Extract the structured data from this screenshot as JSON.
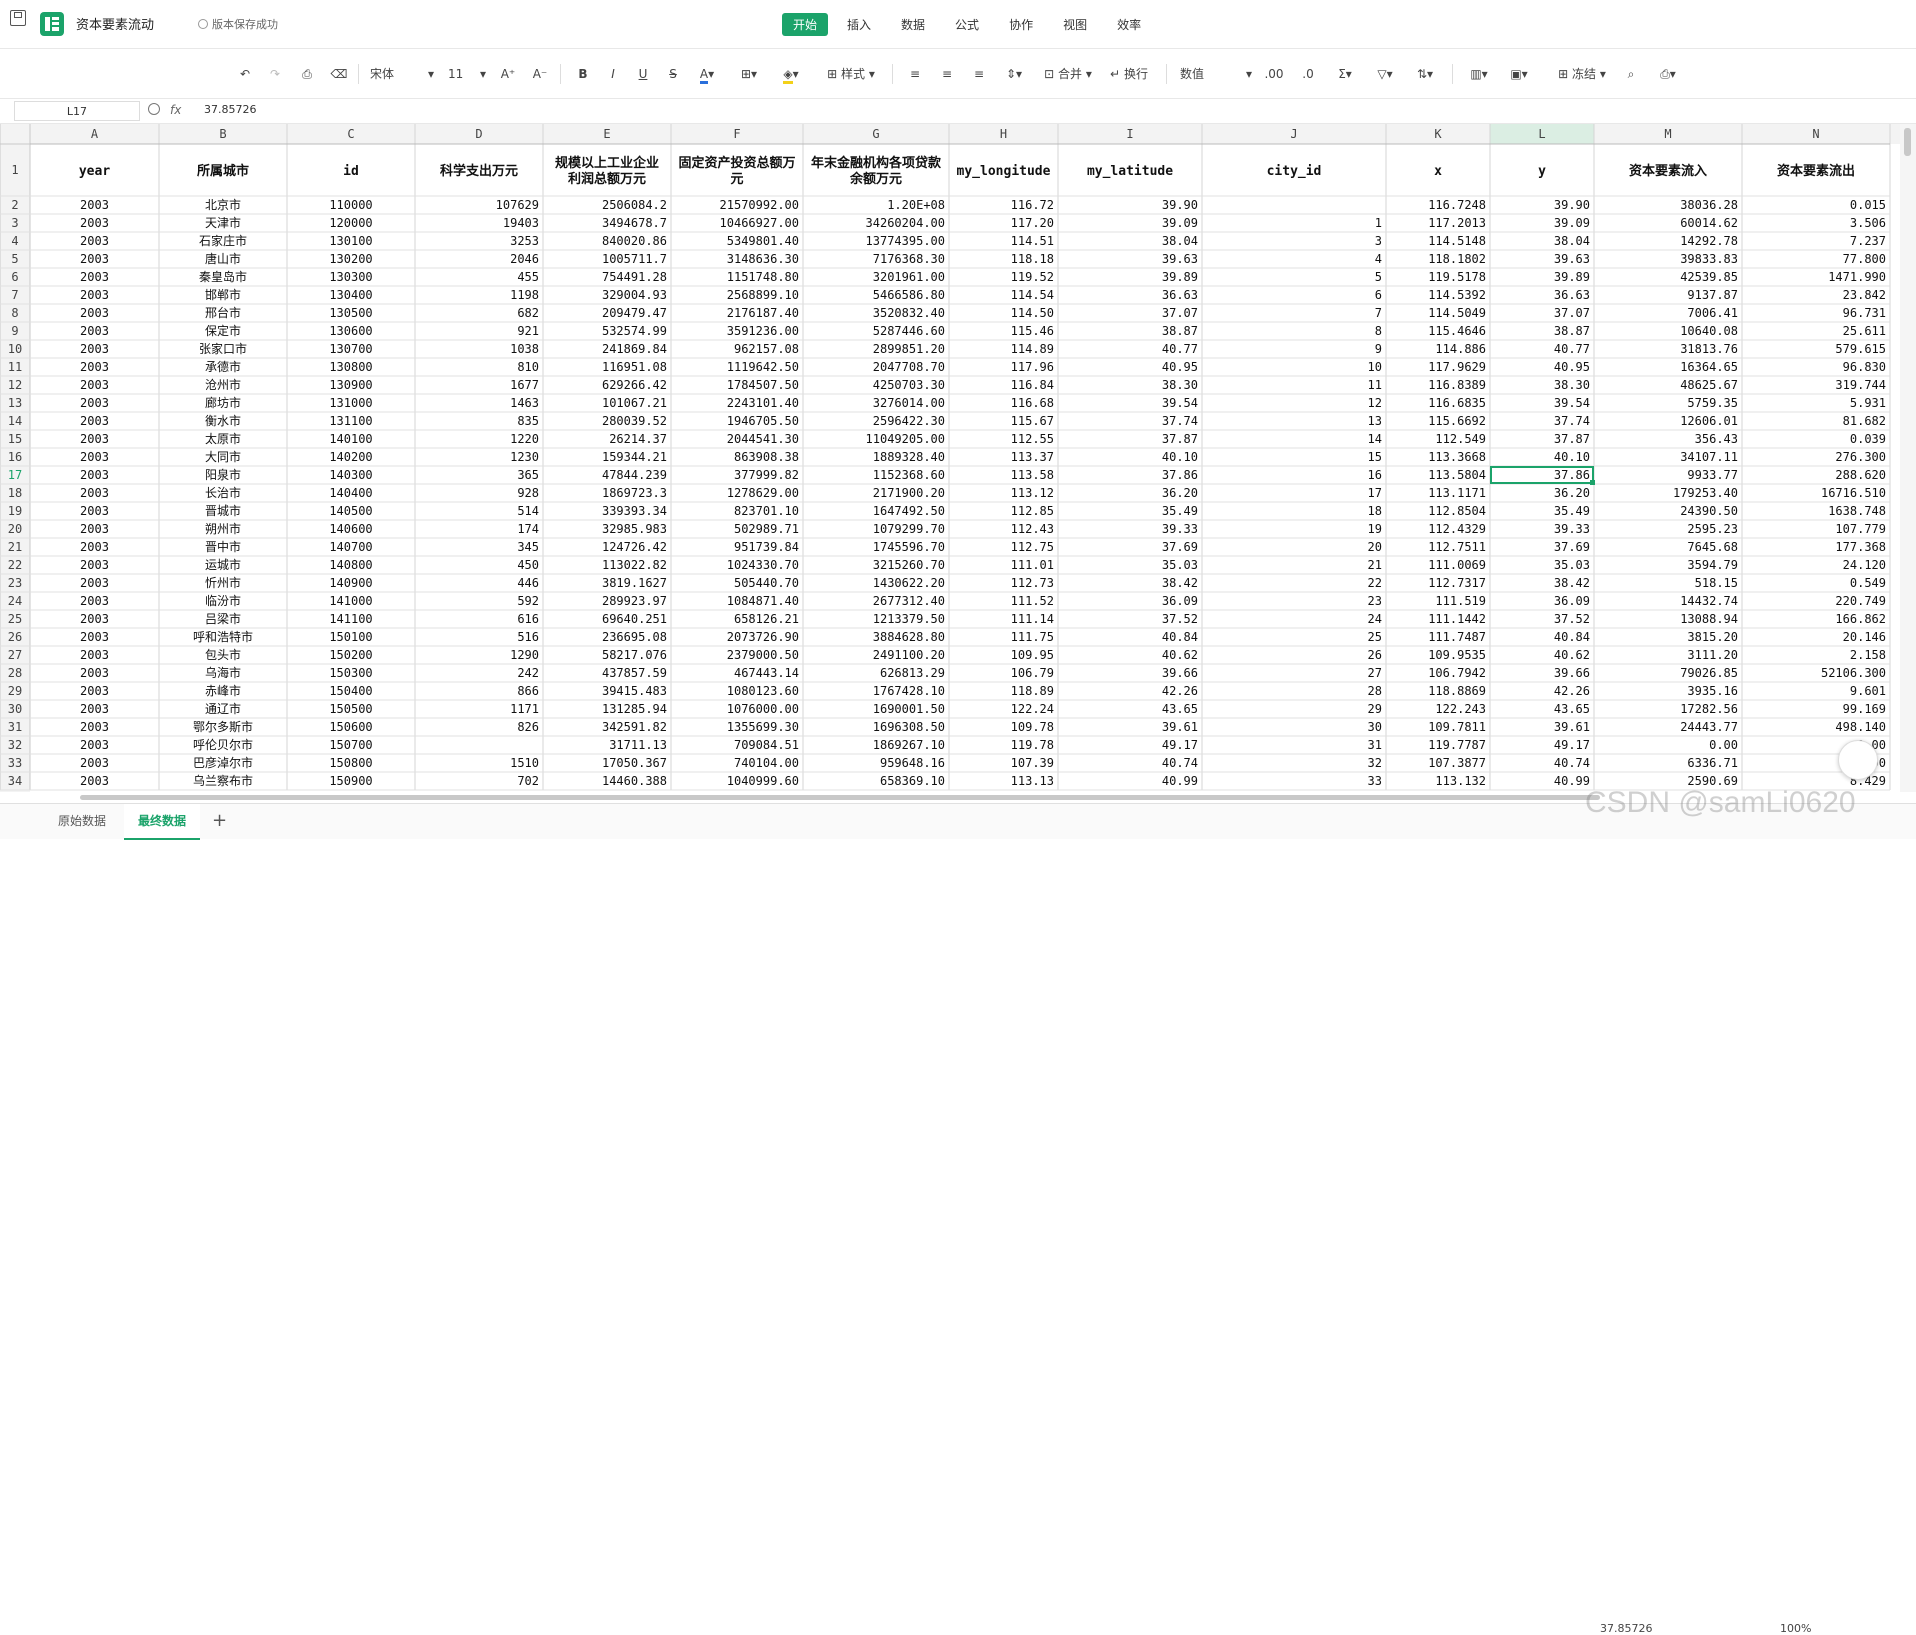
{
  "app": {
    "doc_title": "资本要素流动",
    "save_status": "版本保存成功",
    "menu": [
      "开始",
      "插入",
      "数据",
      "公式",
      "协作",
      "视图",
      "效率"
    ]
  },
  "toolbar": {
    "font_name": "宋体",
    "font_size": "11",
    "style_label": "样式",
    "merge_label": "合并",
    "wrap_label": "换行",
    "number_format": "数值",
    "freeze_label": "冻结"
  },
  "formula_bar": {
    "cell_ref": "L17",
    "fx": "fx",
    "value": "37.85726"
  },
  "sheet": {
    "columns": [
      "A",
      "B",
      "C",
      "D",
      "E",
      "F",
      "G",
      "H",
      "I",
      "J",
      "K",
      "L",
      "M",
      "N"
    ],
    "headers": [
      "year",
      "所属城市",
      "id",
      "科学支出万元",
      "规模以上工业企业利润总额万元",
      "固定资产投资总额万元",
      "年末金融机构各项贷款余额万元",
      "my_longitude",
      "my_latitude",
      "city_id",
      "x",
      "y",
      "资本要素流入",
      "资本要素流出"
    ],
    "rows": [
      [
        "2003",
        "北京市",
        "110000",
        "107629",
        "2506084.2",
        "21570992.00",
        "1.20E+08",
        "116.72",
        "39.90",
        "",
        "116.7248",
        "39.90",
        "38036.28",
        "0.015"
      ],
      [
        "2003",
        "天津市",
        "120000",
        "19403",
        "3494678.7",
        "10466927.00",
        "34260204.00",
        "117.20",
        "39.09",
        "1",
        "117.2013",
        "39.09",
        "60014.62",
        "3.506"
      ],
      [
        "2003",
        "石家庄市",
        "130100",
        "3253",
        "840020.86",
        "5349801.40",
        "13774395.00",
        "114.51",
        "38.04",
        "3",
        "114.5148",
        "38.04",
        "14292.78",
        "7.237"
      ],
      [
        "2003",
        "唐山市",
        "130200",
        "2046",
        "1005711.7",
        "3148636.30",
        "7176368.30",
        "118.18",
        "39.63",
        "4",
        "118.1802",
        "39.63",
        "39833.83",
        "77.800"
      ],
      [
        "2003",
        "秦皇岛市",
        "130300",
        "455",
        "754491.28",
        "1151748.80",
        "3201961.00",
        "119.52",
        "39.89",
        "5",
        "119.5178",
        "39.89",
        "42539.85",
        "1471.990"
      ],
      [
        "2003",
        "邯郸市",
        "130400",
        "1198",
        "329004.93",
        "2568899.10",
        "5466586.80",
        "114.54",
        "36.63",
        "6",
        "114.5392",
        "36.63",
        "9137.87",
        "23.842"
      ],
      [
        "2003",
        "邢台市",
        "130500",
        "682",
        "209479.47",
        "2176187.40",
        "3520832.40",
        "114.50",
        "37.07",
        "7",
        "114.5049",
        "37.07",
        "7006.41",
        "96.731"
      ],
      [
        "2003",
        "保定市",
        "130600",
        "921",
        "532574.99",
        "3591236.00",
        "5287446.60",
        "115.46",
        "38.87",
        "8",
        "115.4646",
        "38.87",
        "10640.08",
        "25.611"
      ],
      [
        "2003",
        "张家口市",
        "130700",
        "1038",
        "241869.84",
        "962157.08",
        "2899851.20",
        "114.89",
        "40.77",
        "9",
        "114.886",
        "40.77",
        "31813.76",
        "579.615"
      ],
      [
        "2003",
        "承德市",
        "130800",
        "810",
        "116951.08",
        "1119642.50",
        "2047708.70",
        "117.96",
        "40.95",
        "10",
        "117.9629",
        "40.95",
        "16364.65",
        "96.830"
      ],
      [
        "2003",
        "沧州市",
        "130900",
        "1677",
        "629266.42",
        "1784507.50",
        "4250703.30",
        "116.84",
        "38.30",
        "11",
        "116.8389",
        "38.30",
        "48625.67",
        "319.744"
      ],
      [
        "2003",
        "廊坊市",
        "131000",
        "1463",
        "101067.21",
        "2243101.40",
        "3276014.00",
        "116.68",
        "39.54",
        "12",
        "116.6835",
        "39.54",
        "5759.35",
        "5.931"
      ],
      [
        "2003",
        "衡水市",
        "131100",
        "835",
        "280039.52",
        "1946705.50",
        "2596422.30",
        "115.67",
        "37.74",
        "13",
        "115.6692",
        "37.74",
        "12606.01",
        "81.682"
      ],
      [
        "2003",
        "太原市",
        "140100",
        "1220",
        "26214.37",
        "2044541.30",
        "11049205.00",
        "112.55",
        "37.87",
        "14",
        "112.549",
        "37.87",
        "356.43",
        "0.039"
      ],
      [
        "2003",
        "大同市",
        "140200",
        "1230",
        "159344.21",
        "863908.38",
        "1889328.40",
        "113.37",
        "40.10",
        "15",
        "113.3668",
        "40.10",
        "34107.11",
        "276.300"
      ],
      [
        "2003",
        "阳泉市",
        "140300",
        "365",
        "47844.239",
        "377999.82",
        "1152368.60",
        "113.58",
        "37.86",
        "16",
        "113.5804",
        "37.86",
        "9933.77",
        "288.620"
      ],
      [
        "2003",
        "长治市",
        "140400",
        "928",
        "1869723.3",
        "1278629.00",
        "2171900.20",
        "113.12",
        "36.20",
        "17",
        "113.1171",
        "36.20",
        "179253.40",
        "16716.510"
      ],
      [
        "2003",
        "晋城市",
        "140500",
        "514",
        "339393.34",
        "823701.10",
        "1647492.50",
        "112.85",
        "35.49",
        "18",
        "112.8504",
        "35.49",
        "24390.50",
        "1638.748"
      ],
      [
        "2003",
        "朔州市",
        "140600",
        "174",
        "32985.983",
        "502989.71",
        "1079299.70",
        "112.43",
        "39.33",
        "19",
        "112.4329",
        "39.33",
        "2595.23",
        "107.779"
      ],
      [
        "2003",
        "晋中市",
        "140700",
        "345",
        "124726.42",
        "951739.84",
        "1745596.70",
        "112.75",
        "37.69",
        "20",
        "112.7511",
        "37.69",
        "7645.68",
        "177.368"
      ],
      [
        "2003",
        "运城市",
        "140800",
        "450",
        "113022.82",
        "1024330.70",
        "3215260.70",
        "111.01",
        "35.03",
        "21",
        "111.0069",
        "35.03",
        "3594.79",
        "24.120"
      ],
      [
        "2003",
        "忻州市",
        "140900",
        "446",
        "3819.1627",
        "505440.70",
        "1430622.20",
        "112.73",
        "38.42",
        "22",
        "112.7317",
        "38.42",
        "518.15",
        "0.549"
      ],
      [
        "2003",
        "临汾市",
        "141000",
        "592",
        "289923.97",
        "1084871.40",
        "2677312.40",
        "111.52",
        "36.09",
        "23",
        "111.519",
        "36.09",
        "14432.74",
        "220.749"
      ],
      [
        "2003",
        "吕梁市",
        "141100",
        "616",
        "69640.251",
        "658126.21",
        "1213379.50",
        "111.14",
        "37.52",
        "24",
        "111.1442",
        "37.52",
        "13088.94",
        "166.862"
      ],
      [
        "2003",
        "呼和浩特市",
        "150100",
        "516",
        "236695.08",
        "2073726.90",
        "3884628.80",
        "111.75",
        "40.84",
        "25",
        "111.7487",
        "40.84",
        "3815.20",
        "20.146"
      ],
      [
        "2003",
        "包头市",
        "150200",
        "1290",
        "58217.076",
        "2379000.50",
        "2491100.20",
        "109.95",
        "40.62",
        "26",
        "109.9535",
        "40.62",
        "3111.20",
        "2.158"
      ],
      [
        "2003",
        "乌海市",
        "150300",
        "242",
        "437857.59",
        "467443.14",
        "626813.29",
        "106.79",
        "39.66",
        "27",
        "106.7942",
        "39.66",
        "79026.85",
        "52106.300"
      ],
      [
        "2003",
        "赤峰市",
        "150400",
        "866",
        "39415.483",
        "1080123.60",
        "1767428.10",
        "118.89",
        "42.26",
        "28",
        "118.8869",
        "42.26",
        "3935.16",
        "9.601"
      ],
      [
        "2003",
        "通辽市",
        "150500",
        "1171",
        "131285.94",
        "1076000.00",
        "1690001.50",
        "122.24",
        "43.65",
        "29",
        "122.243",
        "43.65",
        "17282.56",
        "99.169"
      ],
      [
        "2003",
        "鄂尔多斯市",
        "150600",
        "826",
        "342591.82",
        "1355699.30",
        "1696308.50",
        "109.78",
        "39.61",
        "30",
        "109.7811",
        "39.61",
        "24443.77",
        "498.140"
      ],
      [
        "2003",
        "呼伦贝尔市",
        "150700",
        "",
        "31711.13",
        "709084.51",
        "1869267.10",
        "119.78",
        "49.17",
        "31",
        "119.7787",
        "49.17",
        "0.00",
        "0.00"
      ],
      [
        "2003",
        "巴彦淖尔市",
        "150800",
        "1510",
        "17050.367",
        "740104.00",
        "959648.16",
        "107.39",
        "40.74",
        "32",
        "107.3877",
        "40.74",
        "6336.71",
        "0.00"
      ],
      [
        "2003",
        "乌兰察布市",
        "150900",
        "702",
        "14460.388",
        "1040999.60",
        "658369.10",
        "113.13",
        "40.99",
        "33",
        "113.132",
        "40.99",
        "2590.69",
        "8.429"
      ]
    ]
  },
  "sheet_tabs": [
    "原始数据",
    "最终数据"
  ],
  "status_bar": {
    "value": "37.85726",
    "zoom": "100%"
  },
  "watermark": "CSDN @samLi0620"
}
